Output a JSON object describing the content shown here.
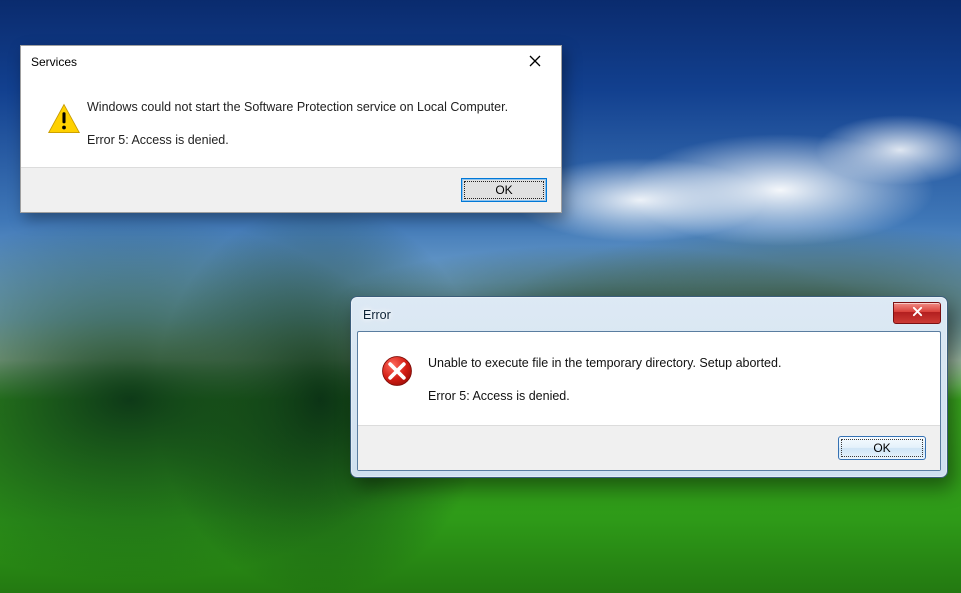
{
  "dialog_services": {
    "title": "Services",
    "message_line1": "Windows could not start the Software Protection service on Local Computer.",
    "message_line2": "Error 5: Access is denied.",
    "ok_label": "OK"
  },
  "dialog_error": {
    "title": "Error",
    "message_line1": "Unable to execute file in the temporary directory. Setup aborted.",
    "message_line2": "Error 5: Access is denied.",
    "ok_label": "OK"
  }
}
